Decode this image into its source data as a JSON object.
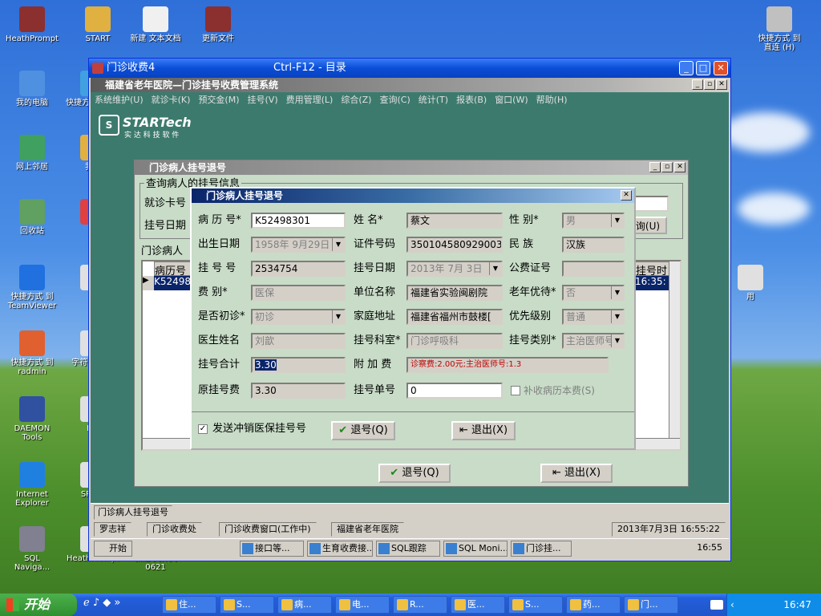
{
  "desktop": {
    "icons": [
      {
        "label": "HeathPrompt",
        "icon": "archive-icon"
      },
      {
        "label": "START",
        "icon": "folder-shortcut-icon"
      },
      {
        "label": "新建 文本文档",
        "icon": "text-document-icon"
      },
      {
        "label": "更新文件",
        "icon": "archive-icon"
      },
      {
        "label": "快捷方式 到\n直连 (H)",
        "icon": "drive-shortcut-icon"
      },
      {
        "label": "我的电脑",
        "icon": "computer-icon"
      },
      {
        "label": "快捷方式 到 so",
        "icon": "shortcut-icon"
      },
      {
        "label": "网上邻居",
        "icon": "network-icon"
      },
      {
        "label": "我的",
        "icon": "folder-icon"
      },
      {
        "label": "回收站",
        "icon": "recycle-bin-icon"
      },
      {
        "label": "",
        "icon": "shortcut-icon"
      },
      {
        "label": "快捷方式 到\nTeamViewer",
        "icon": "teamviewer-icon"
      },
      {
        "label": "项",
        "icon": "shortcut-icon"
      },
      {
        "label": "快捷方式 到\nradmin",
        "icon": "radmin-icon"
      },
      {
        "label": "字符编 小处",
        "icon": "shortcut-icon"
      },
      {
        "label": "DAEMON Tools",
        "icon": "daemon-tools-icon"
      },
      {
        "label": "Pro",
        "icon": "shortcut-icon"
      },
      {
        "label": "Internet\nExplorer",
        "icon": "ie-icon"
      },
      {
        "label": "SP_ZY",
        "icon": "shortcut-icon"
      },
      {
        "label": "SQL\nNaviga...",
        "icon": "sql-navigator-icon"
      },
      {
        "label": "HeathPrompt",
        "icon": "shortcut-icon"
      },
      {
        "label": "新建 文件夹\n0621",
        "icon": "folder-icon"
      },
      {
        "label": "用",
        "icon": "shortcut-icon"
      }
    ]
  },
  "outer_window": {
    "title": "门诊收费4",
    "title_center": "Ctrl-F12 - 目录"
  },
  "app_window": {
    "title": "福建省老年医院—门诊挂号收费管理系统",
    "menu": [
      "系统维护(U)",
      "就诊卡(K)",
      "预交金(M)",
      "挂号(V)",
      "费用管理(L)",
      "综合(Z)",
      "查询(C)",
      "统计(T)",
      "报表(B)",
      "窗口(W)",
      "帮助(H)"
    ],
    "logo_text": "STARTech",
    "logo_sub": "实 达 科 技 软 件"
  },
  "back_dialog": {
    "title": "门诊病人挂号退号",
    "group_label": "查询病人的挂号信息",
    "card_label": "就诊卡号",
    "date_label": "挂号日期",
    "list_label": "门诊病人",
    "query_button": "询(U)",
    "col_left": "病历号",
    "col_right": "挂号时",
    "row_left": "K52498",
    "row_right": "16:35:",
    "refund_button": "退号(Q)",
    "exit_button": "退出(X)"
  },
  "front_dialog": {
    "title": "门诊病人挂号退号",
    "rows": [
      [
        {
          "label": "病 历 号*",
          "value": "K52498301",
          "state": "edit"
        },
        {
          "label": "姓    名*",
          "value": "蔡文",
          "state": "ro"
        },
        {
          "label": "性    别*",
          "value": "男",
          "state": "combo"
        }
      ],
      [
        {
          "label": "出生日期",
          "value": "1958年 9月29日",
          "state": "combo"
        },
        {
          "label": "证件号码",
          "value": "350104580929003",
          "state": "ro"
        },
        {
          "label": "民    族",
          "value": "汉族",
          "state": "ro"
        }
      ],
      [
        {
          "label": "挂 号 号",
          "value": "2534754",
          "state": "ro"
        },
        {
          "label": "挂号日期",
          "value": "2013年 7月 3日",
          "state": "combo"
        },
        {
          "label": "公费证号",
          "value": "",
          "state": "ro"
        }
      ],
      [
        {
          "label": "费    别*",
          "value": "医保",
          "state": "dis"
        },
        {
          "label": "单位名称",
          "value": "福建省实验闽剧院",
          "state": "ro"
        },
        {
          "label": "老年优待*",
          "value": "否",
          "state": "combo"
        }
      ],
      [
        {
          "label": "是否初诊*",
          "value": "初诊",
          "state": "combo"
        },
        {
          "label": "家庭地址",
          "value": "福建省福州市鼓楼[",
          "state": "ro"
        },
        {
          "label": "优先级别",
          "value": "普通",
          "state": "combo"
        }
      ],
      [
        {
          "label": "医生姓名",
          "value": "刘歆",
          "state": "dis"
        },
        {
          "label": "挂号科室*",
          "value": "门诊呼吸科",
          "state": "dis"
        },
        {
          "label": "挂号类别*",
          "value": "主治医师号",
          "state": "combo"
        }
      ]
    ],
    "total_label": "挂号合计",
    "total_value": "3.30",
    "surcharge_label": "附 加 费",
    "surcharge_value": "诊察费:2.00元;主治医师号:1.3",
    "orig_label": "原挂号费",
    "orig_value": "3.30",
    "slip_label": "挂号单号",
    "slip_value": "0",
    "supplement_label": "补收病历本费(S)",
    "send_cancel_label": "发送冲销医保挂号号",
    "send_cancel_checked": true,
    "refund_button": "退号(Q)",
    "exit_button": "退出(X)"
  },
  "mdi_tab": "门诊病人挂号退号",
  "status_bar": [
    "罗志祥",
    "门诊收费处",
    "门诊收费窗口(工作中)",
    "福建省老年医院",
    "2013年7月3日 16:55:22"
  ],
  "inner_taskbar": {
    "start": "开始",
    "tasks": [
      "接口等...",
      "生育收费接...",
      "SQL跟踪",
      "SQL Moni...",
      "门诊挂..."
    ],
    "clock": "16:55"
  },
  "taskbar": {
    "start": "开始",
    "tasks": [
      "住...",
      "S...",
      "病...",
      "电...",
      "R...",
      "医...",
      "S...",
      "药...",
      "门..."
    ],
    "clock": "16:47"
  }
}
